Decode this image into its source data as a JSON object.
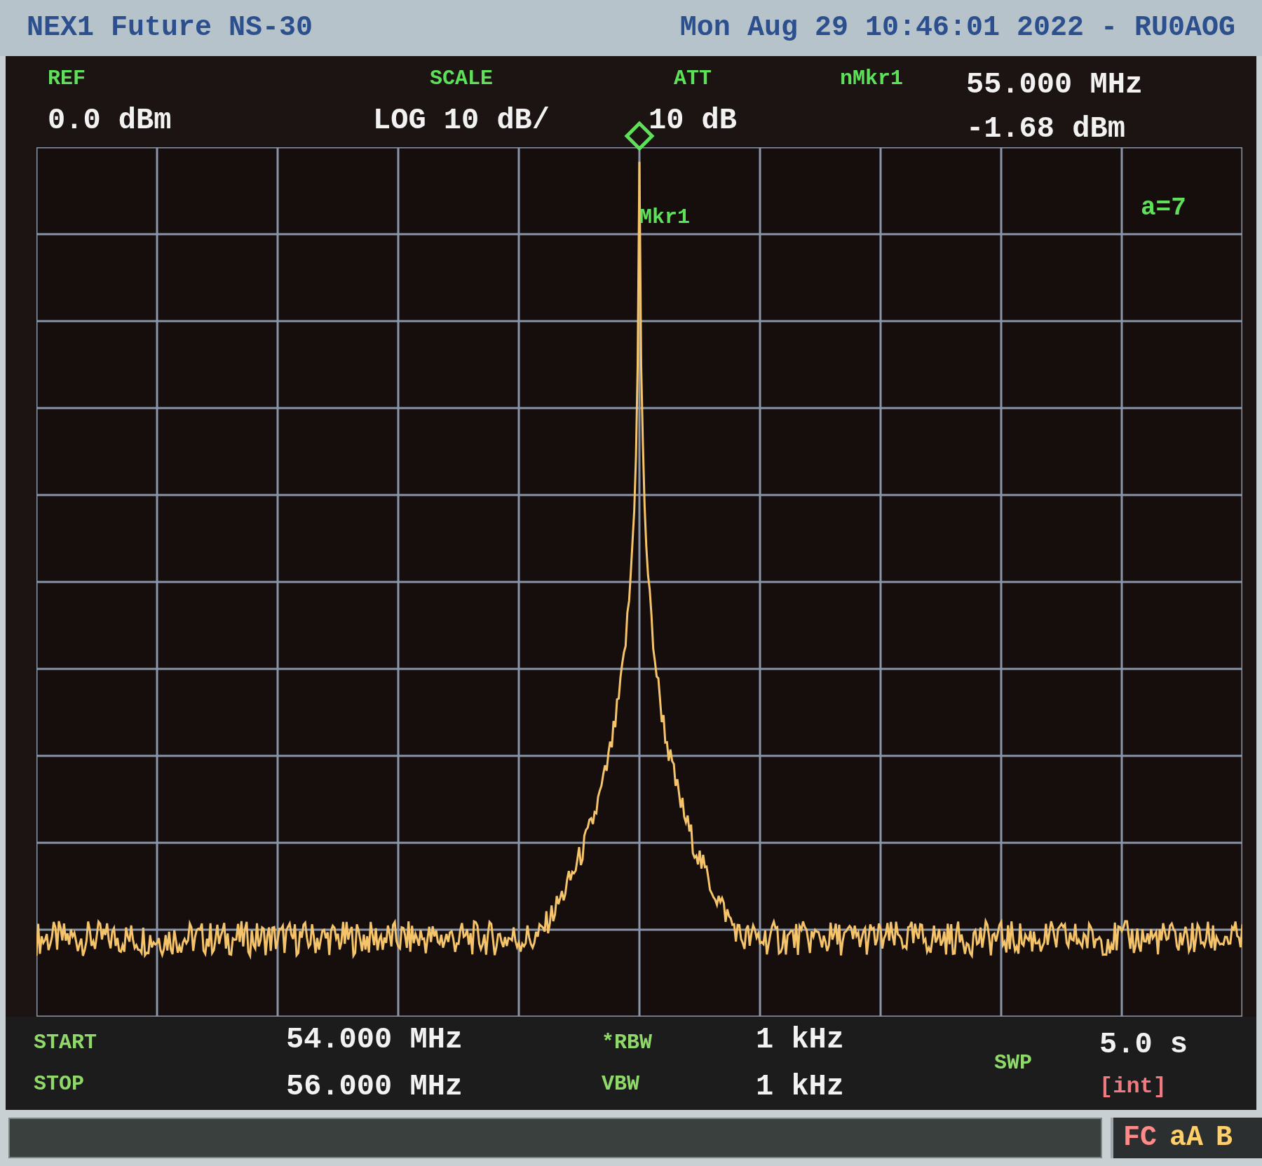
{
  "title_bar": {
    "instrument": "NEX1 Future NS-30",
    "datetime": "Mon Aug 29 10:46:01 2022 - RU0AOG"
  },
  "header": [
    {
      "label": "REF",
      "value": "0.0 dBm"
    },
    {
      "label": "SCALE",
      "value": "LOG 10 dB/"
    },
    {
      "label": "ATT",
      "value": "10 dB"
    }
  ],
  "marker_readout": {
    "label": "nMkr1",
    "frequency": "55.000 MHz",
    "amplitude": "-1.68 dBm"
  },
  "plot": {
    "marker_label": "Mkr1",
    "averaging": "a=7"
  },
  "footer_frequency": [
    {
      "label": "START",
      "value": "54.000 MHz"
    },
    {
      "label": "STOP",
      "value": "56.000 MHz"
    }
  ],
  "footer_bandwidth": [
    {
      "label": "*RBW",
      "value": "1 kHz"
    },
    {
      "label": "VBW",
      "value": "1 kHz"
    }
  ],
  "sweep": {
    "label": "SWP",
    "value": "5.0 s",
    "mode": "[int]"
  },
  "status_bar": {
    "indicators": [
      {
        "text": "FC",
        "color": "#ff8a8a"
      },
      {
        "text": "aA",
        "color": "#ffcf6a"
      },
      {
        "text": "B",
        "color": "#ffcf6a"
      }
    ]
  }
}
